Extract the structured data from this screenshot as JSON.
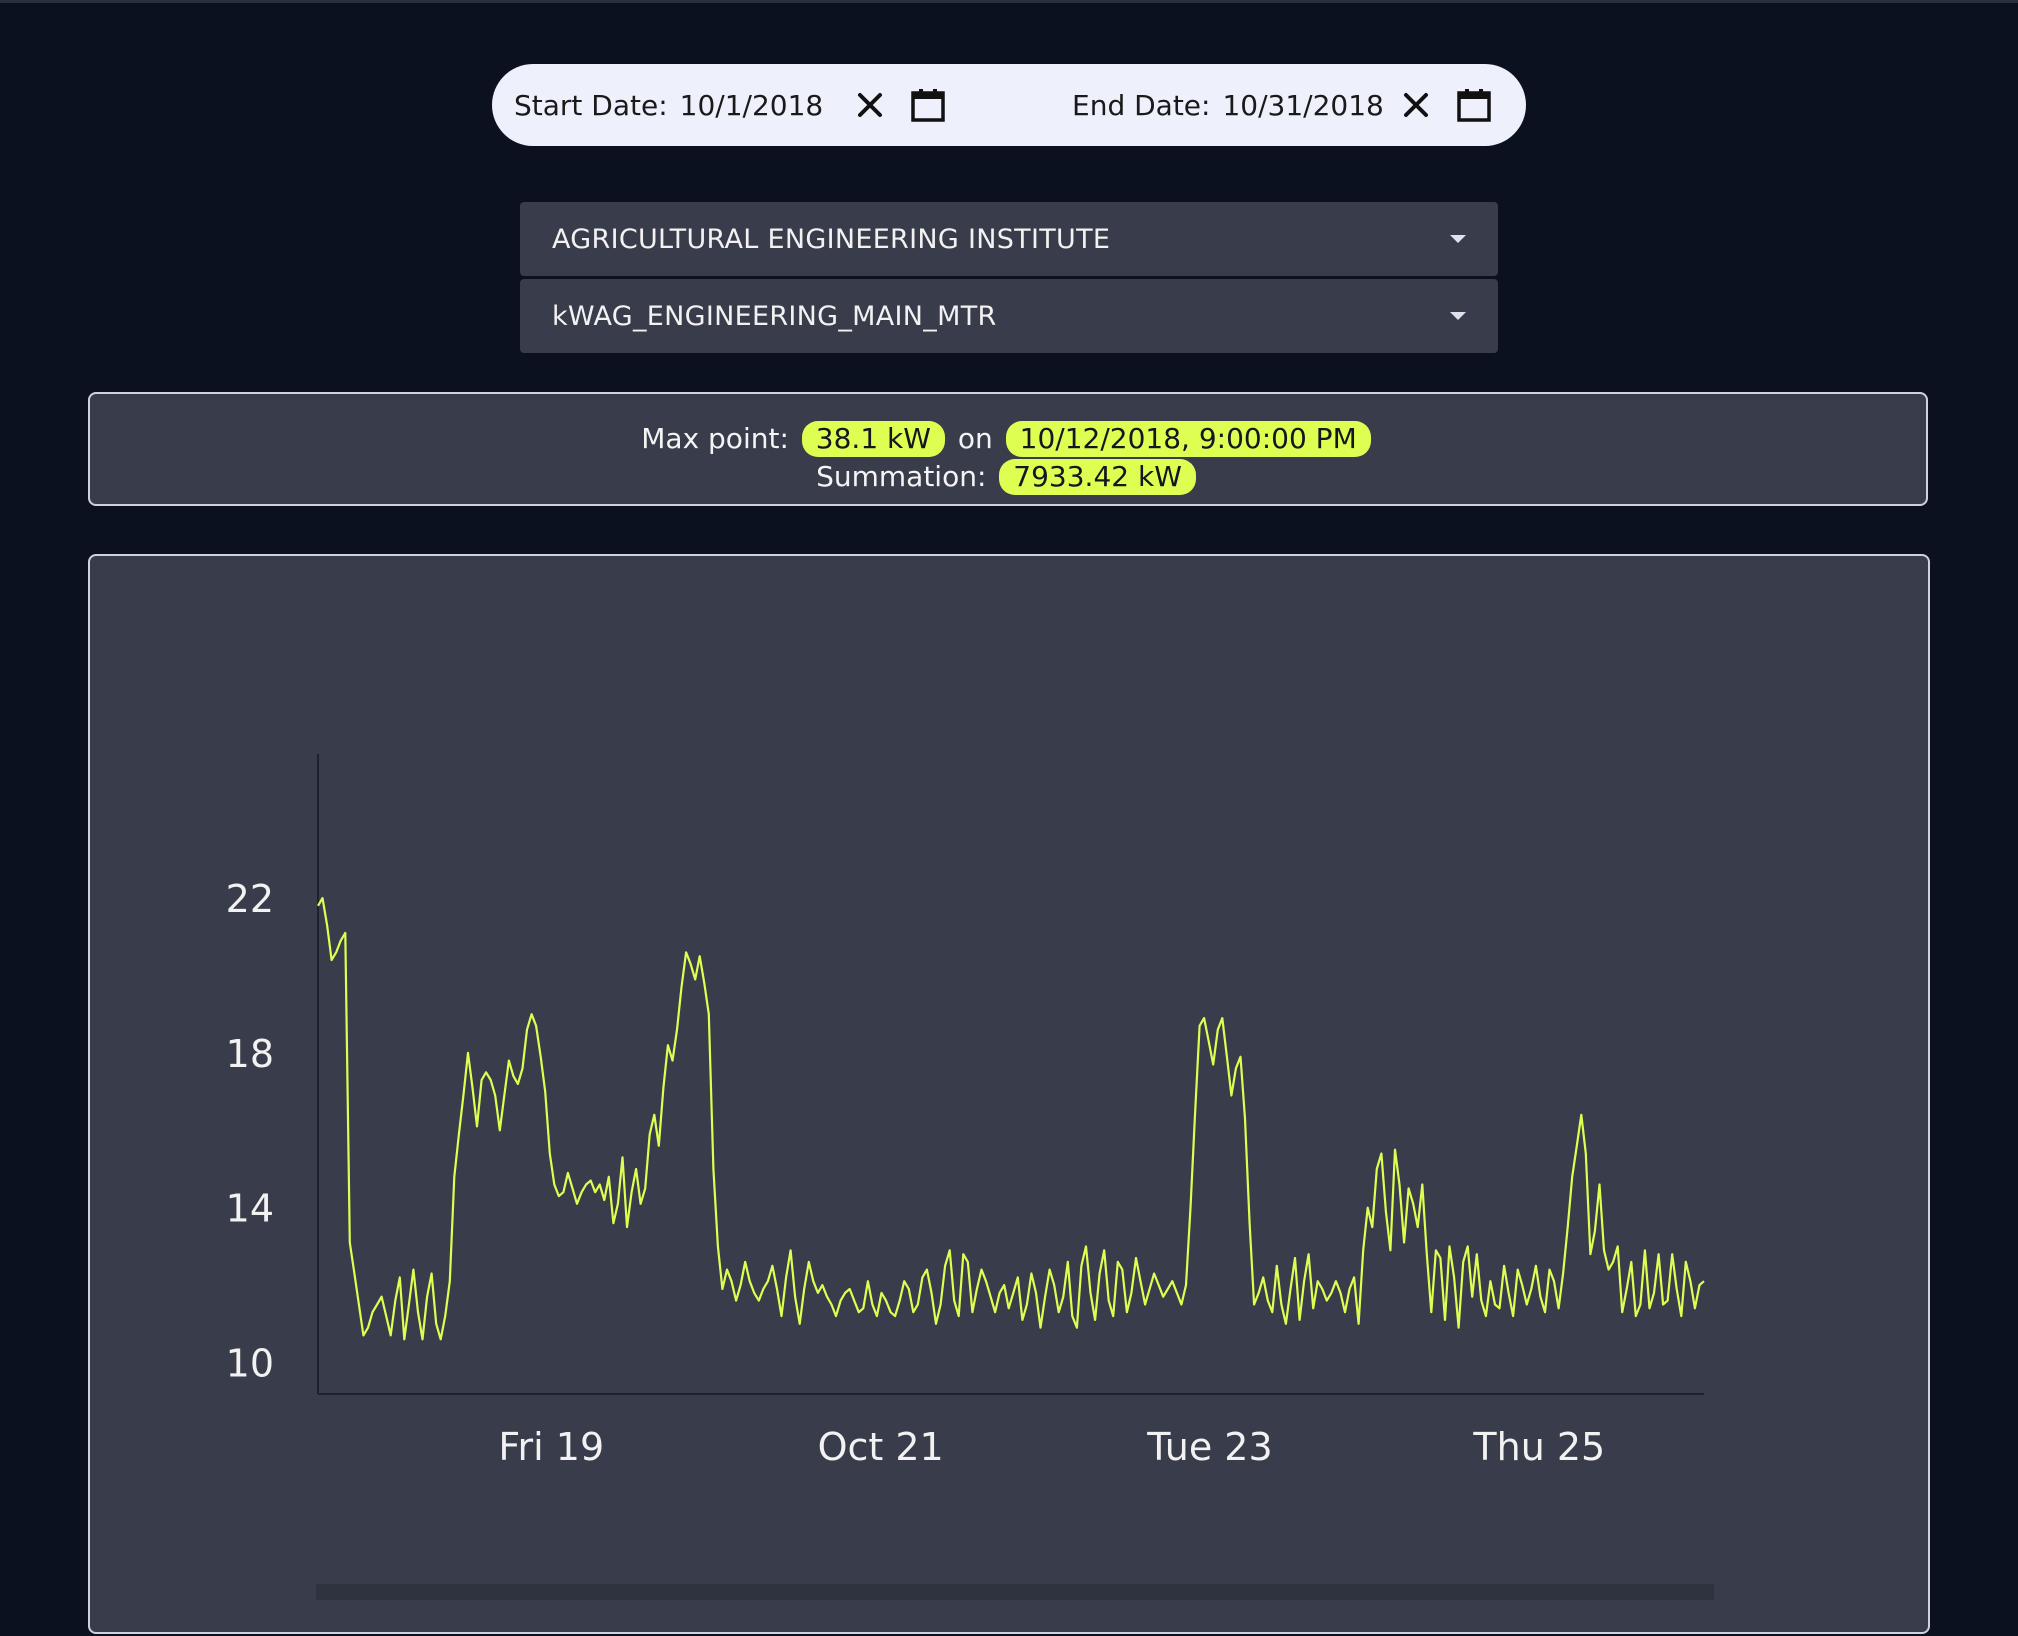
{
  "date_filter": {
    "start_label": "Start Date:",
    "start_value": "10/1/2018",
    "end_label": "End Date:",
    "end_value": "10/31/2018",
    "icons": [
      "close-icon",
      "calendar-icon"
    ]
  },
  "selectors": {
    "building": "AGRICULTURAL ENGINEERING INSTITUTE",
    "meter": "kWAG_ENGINEERING_MAIN_MTR"
  },
  "stats": {
    "max_label": "Max point:",
    "max_value": "38.1 kW",
    "on_label": "on",
    "max_time": "10/12/2018, 9:00:00 PM",
    "sum_label": "Summation:",
    "sum_value": "7933.42 kW"
  },
  "colors": {
    "background": "#0c1120",
    "panel": "#393d4b",
    "accent": "#deff52",
    "line": "#deff52"
  },
  "chart_data": {
    "type": "line",
    "title": "",
    "xlabel": "",
    "ylabel": "",
    "ylim": [
      9.6,
      25.0
    ],
    "xlim": [
      "2018-10-17T14:00",
      "2018-10-26T00:00"
    ],
    "yticks": [
      10,
      14,
      18,
      22
    ],
    "xticks": [
      {
        "label": "Fri 19",
        "x": "2018-10-19T00:00"
      },
      {
        "label": "Oct 21",
        "x": "2018-10-21T00:00"
      },
      {
        "label": "Tue 23",
        "x": "2018-10-23T00:00"
      },
      {
        "label": "Thu 25",
        "x": "2018-10-25T00:00"
      }
    ],
    "grid": false,
    "series": [
      {
        "color": "#deff52",
        "values": [
          21.8,
          22.0,
          21.3,
          20.4,
          20.6,
          20.9,
          21.1,
          13.1,
          12.3,
          11.5,
          10.7,
          10.9,
          11.3,
          11.5,
          11.7,
          11.2,
          10.7,
          11.6,
          12.2,
          10.6,
          11.5,
          12.4,
          11.3,
          10.6,
          11.7,
          12.3,
          11.0,
          10.6,
          11.2,
          12.1,
          14.8,
          15.9,
          16.9,
          18.0,
          17.1,
          16.1,
          17.3,
          17.5,
          17.3,
          16.9,
          16.0,
          16.9,
          17.8,
          17.4,
          17.2,
          17.6,
          18.6,
          19.0,
          18.7,
          17.9,
          17.0,
          15.4,
          14.6,
          14.3,
          14.4,
          14.9,
          14.5,
          14.1,
          14.4,
          14.6,
          14.7,
          14.4,
          14.6,
          14.2,
          14.8,
          13.6,
          14.1,
          15.3,
          13.5,
          14.4,
          15.0,
          14.1,
          14.5,
          15.9,
          16.4,
          15.6,
          17.1,
          18.2,
          17.8,
          18.6,
          19.7,
          20.6,
          20.3,
          19.9,
          20.5,
          19.8,
          19.0,
          15.0,
          13.0,
          11.9,
          12.4,
          12.1,
          11.6,
          12.0,
          12.6,
          12.1,
          11.8,
          11.6,
          11.9,
          12.1,
          12.5,
          11.9,
          11.2,
          12.2,
          12.9,
          11.7,
          11.0,
          11.9,
          12.6,
          12.1,
          11.8,
          12.0,
          11.7,
          11.5,
          11.2,
          11.6,
          11.8,
          11.9,
          11.6,
          11.3,
          11.4,
          12.1,
          11.5,
          11.2,
          11.8,
          11.6,
          11.3,
          11.2,
          11.6,
          12.1,
          11.9,
          11.3,
          11.5,
          12.2,
          12.4,
          11.8,
          11.0,
          11.5,
          12.5,
          12.9,
          11.6,
          11.2,
          12.8,
          12.6,
          11.3,
          11.9,
          12.4,
          12.1,
          11.7,
          11.3,
          11.8,
          12.0,
          11.4,
          11.8,
          12.2,
          11.1,
          11.5,
          12.3,
          11.8,
          10.9,
          11.7,
          12.4,
          12.0,
          11.3,
          11.7,
          12.6,
          11.2,
          10.9,
          12.5,
          13.0,
          11.8,
          11.1,
          12.3,
          12.9,
          11.6,
          11.2,
          12.6,
          12.4,
          11.3,
          11.8,
          12.7,
          12.1,
          11.5,
          11.9,
          12.3,
          12.0,
          11.7,
          11.9,
          12.1,
          11.8,
          11.5,
          12.0,
          14.0,
          16.4,
          18.7,
          18.9,
          18.3,
          17.7,
          18.6,
          18.9,
          17.9,
          16.9,
          17.6,
          17.9,
          16.3,
          13.6,
          11.5,
          11.8,
          12.2,
          11.6,
          11.3,
          12.5,
          11.5,
          11.0,
          11.9,
          12.7,
          11.1,
          12.1,
          12.8,
          11.4,
          12.1,
          11.9,
          11.6,
          11.8,
          12.1,
          11.8,
          11.3,
          11.9,
          12.2,
          11.0,
          12.9,
          14.0,
          13.5,
          15.0,
          15.4,
          13.9,
          12.9,
          15.5,
          14.6,
          13.1,
          14.5,
          14.1,
          13.5,
          14.6,
          12.8,
          11.3,
          12.9,
          12.7,
          11.1,
          13.0,
          12.2,
          10.9,
          12.6,
          13.0,
          11.7,
          12.8,
          11.6,
          11.2,
          12.1,
          11.5,
          11.4,
          12.5,
          11.8,
          11.2,
          12.4,
          12.0,
          11.5,
          11.9,
          12.5,
          11.7,
          11.3,
          12.4,
          12.1,
          11.4,
          12.3,
          13.5,
          14.8,
          15.6,
          16.4,
          15.4,
          12.8,
          13.4,
          14.6,
          12.9,
          12.4,
          12.6,
          13.0,
          11.3,
          11.9,
          12.6,
          11.2,
          11.5,
          12.9,
          11.4,
          11.8,
          12.8,
          11.5,
          11.6,
          12.8,
          11.9,
          11.2,
          12.6,
          12.1,
          11.4,
          12.0,
          12.1
        ]
      }
    ]
  }
}
